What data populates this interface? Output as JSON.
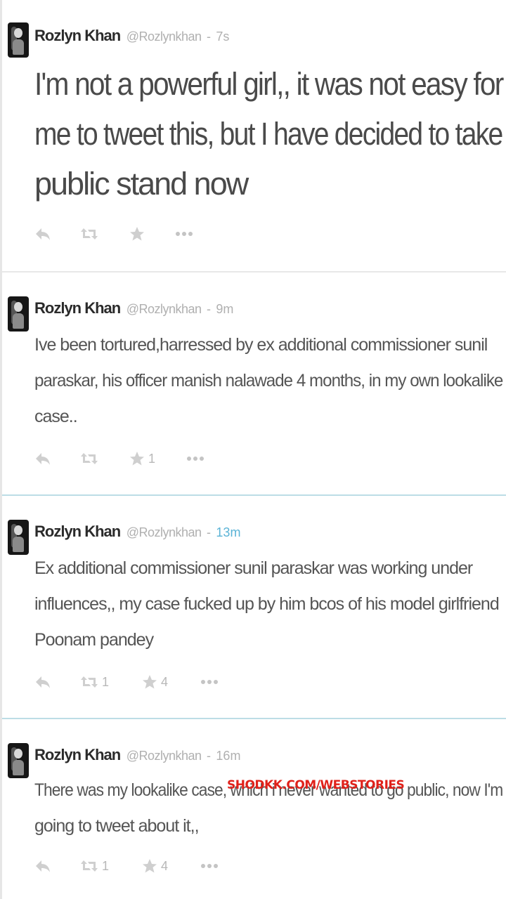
{
  "tweets": [
    {
      "author": "Rozlyn Khan",
      "handle": "@Rozlynkhan",
      "time": "7s",
      "text_lines": [
        "I'm not a powerful girl,, it was not easy for",
        "me to tweet this, but I have decided to take",
        "public stand now"
      ],
      "retweets": "",
      "favorites": ""
    },
    {
      "author": "Rozlyn Khan",
      "handle": "@Rozlynkhan",
      "time": "9m",
      "text_lines": [
        "Ive been tortured,harressed by ex additional commissioner sunil",
        "paraskar, his officer manish nalawade 4 months, in my  own lookalike",
        "case.."
      ],
      "retweets": "",
      "favorites": "1"
    },
    {
      "author": "Rozlyn Khan",
      "handle": "@Rozlynkhan",
      "time": "13m",
      "text_lines": [
        "Ex additional commissioner sunil paraskar was working under",
        "influences,, my case fucked up by him bcos of his model girlfriend",
        "Poonam pandey"
      ],
      "retweets": "1",
      "favorites": "4"
    },
    {
      "author": "Rozlyn Khan",
      "handle": "@Rozlynkhan",
      "time": "16m",
      "text_lines": [
        "There was my lookalike case, which i never wanted to go public, now I'm",
        "going to tweet about it,,"
      ],
      "retweets": "1",
      "favorites": "4"
    }
  ],
  "separator": "-",
  "watermark": "SHODKK.COM/WEBSTORIES",
  "icons": [
    "reply-icon",
    "retweet-icon",
    "favorite-icon",
    "more-icon"
  ],
  "colors": {
    "name": "#2b2b2b",
    "meta": "#b0b0b0",
    "link_time": "#5ab3d6",
    "icon": "#c9c9c9",
    "watermark": "#e0211a"
  }
}
